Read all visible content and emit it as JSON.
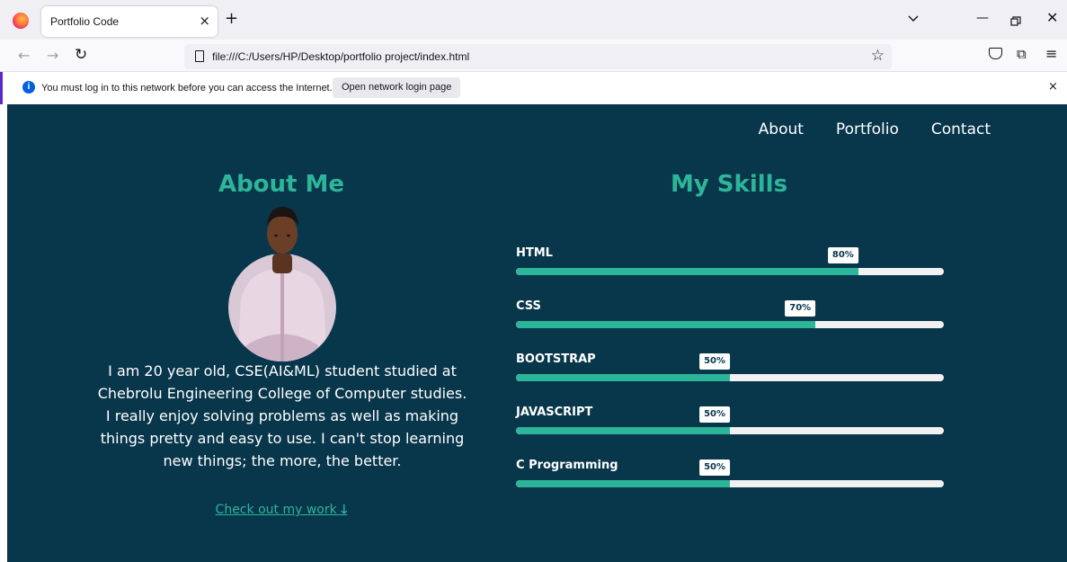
{
  "browser": {
    "tab_title": "Portfolio Code",
    "tab_close": "×",
    "new_tab": "+",
    "url": "file:///C:/Users/HP/Desktop/portfolio project/index.html",
    "infobar": {
      "message": "You must log in to this network before you can access the Internet.",
      "button_label": "Open network login page",
      "close": "×"
    },
    "colors": {
      "infobar_accent": "#592acb",
      "info_icon": "#0060df"
    }
  },
  "site": {
    "nav": [
      "About",
      "Portfolio",
      "Contact"
    ],
    "about": {
      "title": "About Me",
      "text": "I am 20 year old, CSE(AI&ML) student studied at Chebrolu Engineering College of Computer studies. I really enjoy solving problems as well as making things pretty and easy to use. I can't stop learning new things; the more, the better.",
      "link_label": "Check out my work",
      "link_arrow": "🡓"
    },
    "skills_title": "My Skills",
    "skills": [
      {
        "name": "HTML",
        "percent_label": "80%",
        "value": 0.8
      },
      {
        "name": "CSS",
        "percent_label": "70%",
        "value": 0.7
      },
      {
        "name": "BOOTSTRAP",
        "percent_label": "50%",
        "value": 0.5
      },
      {
        "name": "JAVASCRIPT",
        "percent_label": "50%",
        "value": 0.5
      },
      {
        "name": "C Programming",
        "percent_label": "50%",
        "value": 0.5
      }
    ],
    "colors": {
      "background": "#08364b",
      "accent": "#2db59a",
      "text": "#ffffff",
      "track": "#f1f1f1"
    }
  }
}
